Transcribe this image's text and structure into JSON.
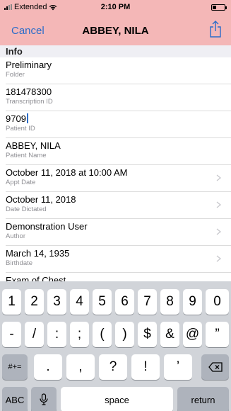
{
  "status": {
    "carrier": "Extended",
    "time": "2:10 PM"
  },
  "nav": {
    "cancel": "Cancel",
    "title": "ABBEY, NILA"
  },
  "section": {
    "title": "Info"
  },
  "rows": [
    {
      "value": "Preliminary",
      "label": "Folder",
      "chevron": false
    },
    {
      "value": "181478300",
      "label": "Transcription ID",
      "chevron": false
    },
    {
      "value": "9709",
      "label": "Patient ID",
      "chevron": false
    },
    {
      "value": "ABBEY, NILA",
      "label": "Patient Name",
      "chevron": false
    },
    {
      "value": "October 11, 2018 at 10:00 AM",
      "label": "Appt Date",
      "chevron": true
    },
    {
      "value": "October 11, 2018",
      "label": "Date Dictated",
      "chevron": true
    },
    {
      "value": "Demonstration User",
      "label": "Author",
      "chevron": true
    },
    {
      "value": "March 14, 1935",
      "label": "Birthdate",
      "chevron": true
    },
    {
      "value": "Exam of Chest",
      "label": "",
      "chevron": false
    }
  ],
  "keyboard": {
    "row1": [
      "1",
      "2",
      "3",
      "4",
      "5",
      "6",
      "7",
      "8",
      "9",
      "0"
    ],
    "row2": [
      "-",
      "/",
      ":",
      ";",
      "(",
      ")",
      "$",
      "&",
      "@",
      "”"
    ],
    "row3_left": "#+=",
    "row3": [
      ".",
      ",",
      "?",
      "!",
      "’"
    ],
    "abc": "ABC",
    "space": "space",
    "return": "return"
  },
  "colors": {
    "nav_bg": "#f4b7b7",
    "accent": "#2a6cc9",
    "keyboard_bg": "#d1d4d9"
  },
  "icons": {
    "share": "share-icon",
    "mic": "microphone-icon",
    "delete": "delete-backward-icon",
    "wifi": "wifi-icon"
  }
}
